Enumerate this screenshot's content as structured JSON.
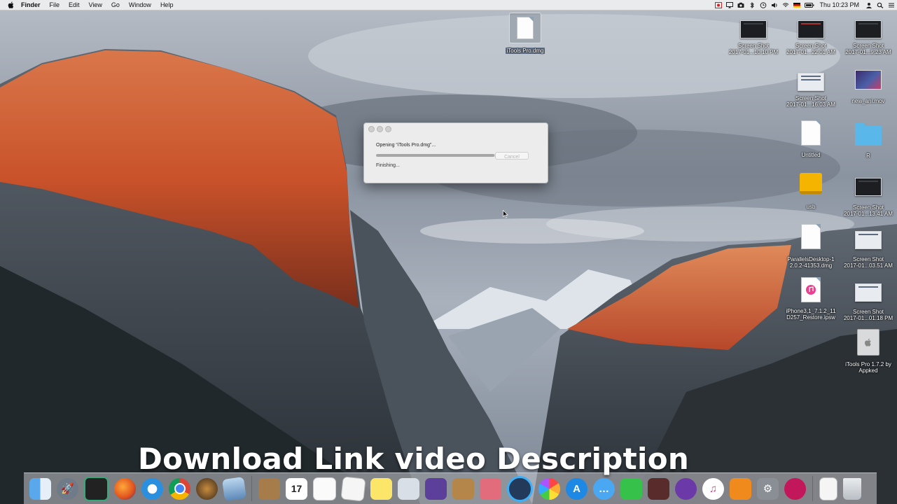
{
  "menubar": {
    "app_name": "Finder",
    "menus": [
      "File",
      "Edit",
      "View",
      "Go",
      "Window",
      "Help"
    ],
    "clock": "Thu 10:23 PM",
    "status_icons": [
      "screen-record-icon",
      "mirroring-icon",
      "camera-icon",
      "bluetooth-icon",
      "time-machine-icon",
      "volume-icon",
      "wifi-icon",
      "flag-icon",
      "battery-icon",
      "user-icon",
      "search-icon",
      "list-icon"
    ]
  },
  "desktop_icons": {
    "top_dmg": "iTools Pro.dmg",
    "shot1": "Screen Shot\n2017-01...10.10 PM",
    "shot2": "Screen Shot\n2017-01...22.01 AM",
    "shot3": "Screen Shot\n2017-01...9.23 AM",
    "shot4": "Screen Shot\n2017-01...16.03 AM",
    "movie": "new_ani.mov",
    "untitled": "Untitled",
    "folder_r": "R",
    "usb": "usb",
    "shot5": "Screen Shot\n2017-01...13.41 AM",
    "parallels": "ParallelsDesktop-1\n2.0.2-41353.dmg",
    "shot6": "Screen Shot\n2017-01...03.51 AM",
    "ipsw": "iPhone3,1_7.1.2_11\nD257_Restore.ipsw",
    "shot7": "Screen Shot\n2017-01...01.18 PM",
    "itools_app": "iTools Pro 1.7.2 by\nAppked"
  },
  "dialog": {
    "opening": "Opening “iTools Pro.dmg”...",
    "cancel": "Cancel",
    "status": "Finishing...",
    "progress": 0.95
  },
  "caption": "Download Link video Description",
  "dock_items": [
    "finder-icon",
    "launchpad-icon",
    "mission-control-icon",
    "firefox-icon",
    "safari-icon",
    "chrome-icon",
    "app-icon",
    "preview-icon",
    "contacts-icon",
    "calendar-icon",
    "reminders-icon",
    "textedit-icon",
    "notes-icon",
    "photo-booth-icon",
    "imovie-icon",
    "archive-utility-icon",
    "mac-app-icon",
    "quicktime-icon",
    "photos-icon",
    "app-store-icon",
    "messages-icon",
    "facetime-icon",
    "photo-app-icon",
    "network-icon",
    "itunes-icon",
    "ibooks-icon",
    "system-preferences-icon",
    "wifi-app-icon",
    "documents-icon",
    "trash-icon"
  ],
  "calendar_day": "17",
  "colors": {
    "accent_blue": "#1e88e5",
    "folder_blue": "#5ab7ea",
    "usb_yellow": "#f4b400"
  }
}
